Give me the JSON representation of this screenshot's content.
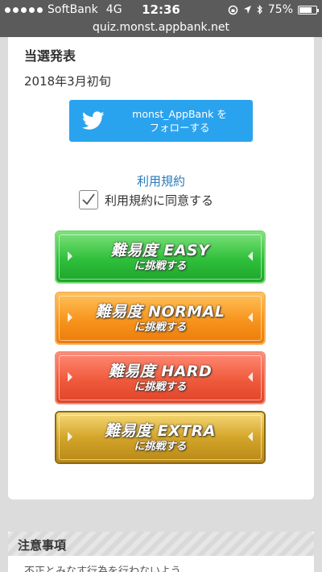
{
  "status_bar": {
    "carrier": "SoftBank",
    "network": "4G",
    "time": "12:36",
    "battery_percent": "75%",
    "battery_level": 0.75
  },
  "url": "quiz.monst.appbank.net",
  "announcement": {
    "title": "当選発表",
    "date": "2018年3月初旬"
  },
  "twitter_button": {
    "line1": "monst_AppBank を",
    "line2": "フォローする",
    "color": "#2aa3ef"
  },
  "terms": {
    "link_label": "利用規約",
    "agree_label": "利用規約に同意する",
    "checked": true
  },
  "difficulty_buttons": [
    {
      "line1": "難易度 EASY",
      "line2": "に挑戦する",
      "color": "#2fbf3b"
    },
    {
      "line1": "難易度 NORMAL",
      "line2": "に挑戦する",
      "color": "#f7941d"
    },
    {
      "line1": "難易度 HARD",
      "line2": "に挑戦する",
      "color": "#f05a3c"
    },
    {
      "line1": "難易度 EXTRA",
      "line2": "に挑戦する",
      "color": "#d4a52a"
    }
  ],
  "notes": {
    "title": "注意事項",
    "text": "不正とみなす行為を行わないよう..."
  }
}
